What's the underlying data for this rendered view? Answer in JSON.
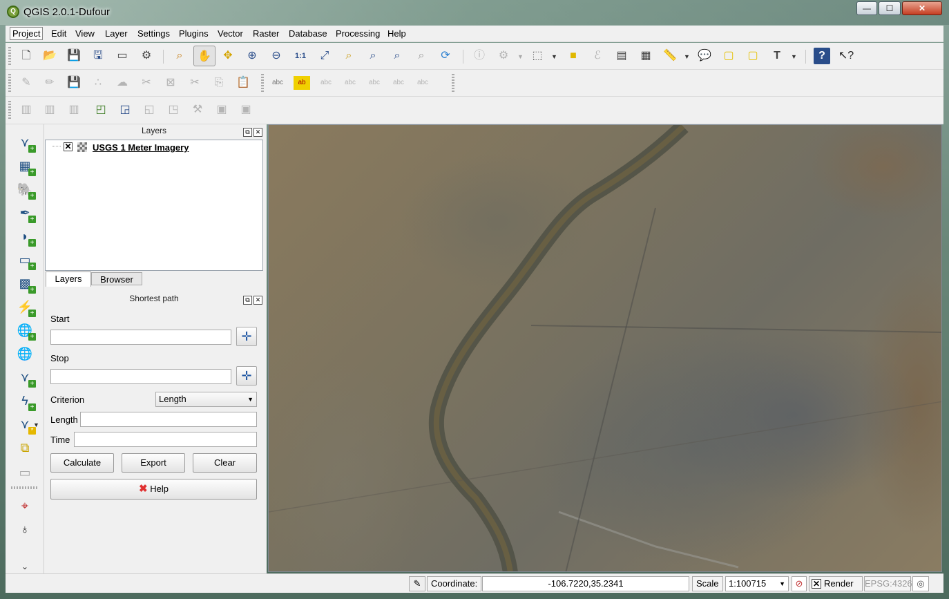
{
  "window": {
    "title": "QGIS 2.0.1-Dufour",
    "min_glyph": "—",
    "max_glyph": "☐",
    "close_glyph": "✕"
  },
  "menu": [
    "Project",
    "Edit",
    "View",
    "Layer",
    "Settings",
    "Plugins",
    "Vector",
    "Raster",
    "Database",
    "Processing",
    "Help"
  ],
  "layers_panel": {
    "title": "Layers",
    "layers": [
      {
        "name": "USGS 1 Meter Imagery",
        "checked_glyph": "✕"
      }
    ]
  },
  "tabs": {
    "layers": "Layers",
    "browser": "Browser"
  },
  "shortest_path": {
    "title": "Shortest path",
    "start_label": "Start",
    "start_value": "",
    "stop_label": "Stop",
    "stop_value": "",
    "criterion_label": "Criterion",
    "criterion_value": "Length",
    "length_label": "Length",
    "length_value": "",
    "time_label": "Time",
    "time_value": "",
    "calculate": "Calculate",
    "export": "Export",
    "clear": "Clear",
    "help": "Help"
  },
  "status": {
    "coordinate_label": "Coordinate:",
    "coordinate_value": "-106.7220,35.2341",
    "scale_label": "Scale",
    "scale_value": "1:100715",
    "render_label": "Render",
    "render_check": "✕",
    "crs": "EPSG:4326"
  },
  "dock_glyphs": {
    "float": "⧉",
    "close": "✕"
  },
  "icons": {
    "toolbar1": [
      "new-project-icon",
      "open-project-icon",
      "save-project-icon",
      "save-as-icon",
      "new-print-composer-icon",
      "composer-manager-icon",
      "pan-to-selection-icon",
      "pan-icon",
      "pan-map-icon",
      "zoom-in-icon",
      "zoom-out-icon",
      "zoom-actual-size-icon",
      "zoom-full-icon",
      "zoom-to-selection-icon",
      "zoom-to-layer-icon",
      "zoom-last-icon",
      "zoom-next-icon",
      "refresh-icon",
      "identify-icon",
      "action-icon",
      "select-icon",
      "deselect-icon",
      "expression-select-icon",
      "attribute-table-icon",
      "statistics-icon",
      "measure-icon",
      "map-tips-icon",
      "new-bookmark-icon",
      "show-bookmarks-icon",
      "text-annotation-icon",
      "help-contents-icon",
      "whats-this-icon"
    ],
    "toolbar2": [
      "current-edits-icon",
      "toggle-editing-icon",
      "save-edits-icon",
      "add-point-icon",
      "move-feature-icon",
      "node-tool-icon",
      "delete-selected-icon",
      "cut-features-icon",
      "copy-features-icon",
      "paste-features-icon",
      "label-icon",
      "layer-labeling-icon",
      "pin-labels-icon",
      "show-hide-labels-icon",
      "move-label-icon",
      "rotate-label-icon",
      "change-label-icon"
    ],
    "toolbar3": [
      "add-ring-icon",
      "add-part-icon",
      "fill-ring-icon",
      "delete-ring-icon",
      "delete-part-icon",
      "reshape-icon",
      "offset-curve-icon",
      "split-parts-icon",
      "split-features-icon",
      "merge-selected-icon"
    ],
    "left": [
      "add-vector-layer-icon",
      "add-raster-layer-icon",
      "add-postgis-layer-icon",
      "add-spatialite-layer-icon",
      "add-mssql-layer-icon",
      "add-oracle-layer-icon",
      "add-sqlanywhere-layer-icon",
      "add-wms-layer-icon",
      "add-wcs-layer-icon",
      "add-wfs-layer-icon",
      "add-delimited-text-icon",
      "new-shapefile-icon",
      "new-spatialite-icon",
      "new-gpx-icon",
      "remove-layer-icon",
      "coordinate-capture-icon",
      "gps-tool-icon",
      "more-icon"
    ]
  }
}
